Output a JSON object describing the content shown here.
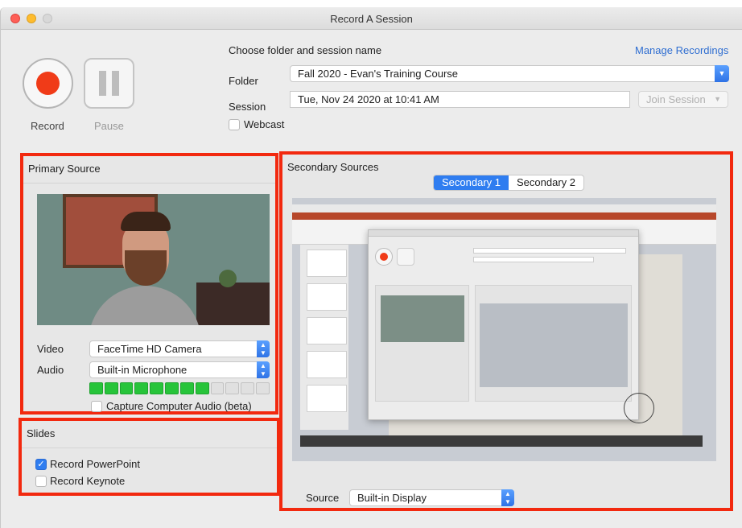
{
  "window": {
    "title": "Record A Session"
  },
  "controls": {
    "record_label": "Record",
    "pause_label": "Pause"
  },
  "session": {
    "heading": "Choose folder and session name",
    "manage_link": "Manage Recordings",
    "folder_label": "Folder",
    "folder_value": "Fall 2020 - Evan's Training Course",
    "session_label": "Session",
    "session_value": "Tue, Nov 24 2020 at 10:41 AM",
    "join_label": "Join Session",
    "webcast_label": "Webcast",
    "webcast_checked": false
  },
  "primary": {
    "title": "Primary Source",
    "video_label": "Video",
    "video_value": "FaceTime HD Camera",
    "audio_label": "Audio",
    "audio_value": "Built-in Microphone",
    "audio_level": {
      "lit_segments": 8,
      "total_segments": 12
    },
    "capture_audio_label": "Capture Computer Audio (beta)",
    "capture_audio_checked": false
  },
  "slides": {
    "title": "Slides",
    "items": [
      {
        "label": "Record PowerPoint",
        "checked": true
      },
      {
        "label": "Record Keynote",
        "checked": false
      }
    ]
  },
  "secondary": {
    "title": "Secondary Sources",
    "tabs": [
      {
        "label": "Secondary 1",
        "active": true
      },
      {
        "label": "Secondary 2",
        "active": false
      }
    ],
    "source_label": "Source",
    "source_value": "Built-in Display"
  },
  "colors": {
    "highlight": "#f2290f",
    "accent": "#2f7df0",
    "record": "#f03b18",
    "meter": "#27c43a"
  },
  "icons": [
    "record-icon",
    "pause-icon",
    "chevron-down-icon",
    "up-down-arrows-icon",
    "checkmark-icon"
  ]
}
